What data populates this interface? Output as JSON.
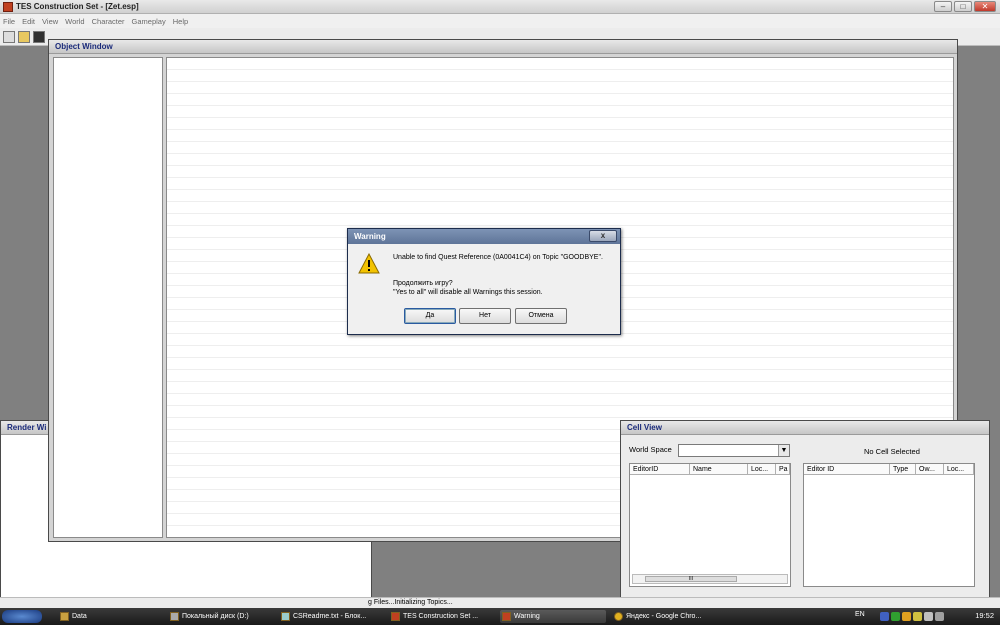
{
  "app": {
    "title": "TES Construction Set - [Zet.esp]"
  },
  "menu": [
    "File",
    "Edit",
    "View",
    "World",
    "Character",
    "Gameplay",
    "Help"
  ],
  "object_window": {
    "title": "Object Window"
  },
  "render_window": {
    "title": "Render Wi"
  },
  "cell_view": {
    "title": "Cell View",
    "world_space_label": "World Space",
    "world_space_value": "",
    "no_cell": "No Cell Selected",
    "cell_columns": [
      "EditorID",
      "Name",
      "Loc...",
      "Pa"
    ],
    "ref_columns": [
      "Editor ID",
      "Type",
      "Ow...",
      "Loc..."
    ]
  },
  "dialog": {
    "title": "Warning",
    "close_glyph": "x",
    "message1": "Unable to find Quest Reference (0A0041C4) on Topic \"GOODBYE\".",
    "message2": "Продолжить игру?",
    "message3": "\"Yes to all\" will disable all Warnings this session.",
    "buttons": [
      "Да",
      "Нет",
      "Отмена"
    ]
  },
  "statusbar": {
    "text": "g Files...Initializing Topics..."
  },
  "taskbar": {
    "tasks": [
      "Data",
      "Покальный диск (D:)",
      "CSReadme.txt - Блок...",
      "TES Construction Set ...",
      "Warning",
      "Яндекс - Google Chro..."
    ],
    "language": "EN",
    "clock": "19:52"
  },
  "colors": {
    "dialog_title": "#6b81a6",
    "child_title_text": "#1a2a7a",
    "taskbar": "#2a2a2a"
  }
}
